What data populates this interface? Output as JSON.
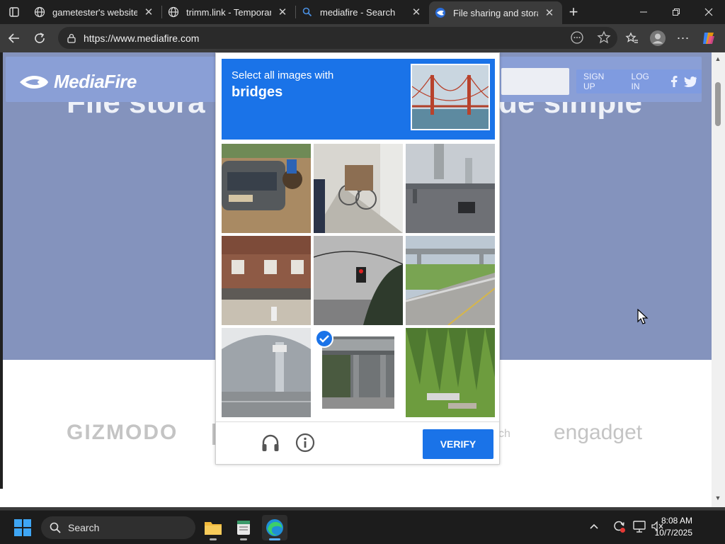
{
  "browser": {
    "tabs": [
      {
        "title": "gametester's website"
      },
      {
        "title": "trimm.link - Temporary URL"
      },
      {
        "title": "mediafire - Search"
      },
      {
        "title": "File sharing and storage made simple"
      }
    ],
    "url": "https://www.mediafire.com"
  },
  "site": {
    "logo": "MediaFire",
    "hero_left": "File stora",
    "hero_right": "de simple",
    "sign_up": "SIGN UP",
    "log_in": "LOG IN",
    "press_left": "GIZMODO",
    "press_mid": "ch",
    "press_right": "engadget"
  },
  "captcha": {
    "prompt": "Select all images with",
    "target": "bridges",
    "verify": "VERIFY",
    "tiles": [
      {
        "index": 0,
        "selected": false
      },
      {
        "index": 1,
        "selected": false
      },
      {
        "index": 2,
        "selected": false
      },
      {
        "index": 3,
        "selected": false
      },
      {
        "index": 4,
        "selected": false
      },
      {
        "index": 5,
        "selected": false
      },
      {
        "index": 6,
        "selected": false
      },
      {
        "index": 7,
        "selected": true
      },
      {
        "index": 8,
        "selected": false
      }
    ]
  },
  "taskbar": {
    "search": "Search",
    "time": "8:08 AM",
    "date": "10/7/2025"
  },
  "colors": {
    "captcha_blue": "#1a73e8",
    "hero_bg": "#8493bd",
    "header_bg": "#8a9fd6"
  }
}
